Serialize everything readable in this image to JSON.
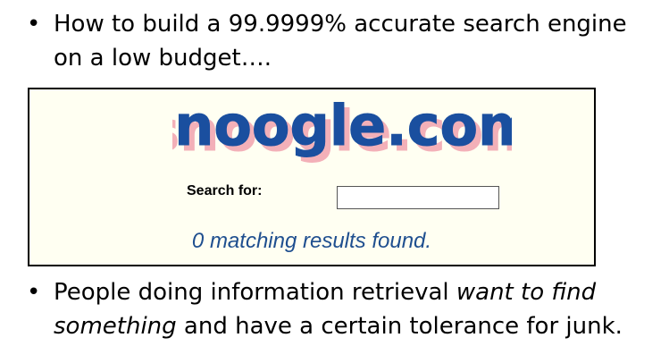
{
  "colors": {
    "logo_blue": "#1a4f9f",
    "logo_pink": "#f3b0b8",
    "results_text": "#1f4f8f",
    "frame_background": "#fffff2"
  },
  "bullets": [
    {
      "marker": "•",
      "text": "How to build a 99.9999% accurate search engine on a low budget…."
    },
    {
      "marker": "•",
      "text_pre": "People doing information retrieval ",
      "text_emphasis": "want to find something",
      "text_post": " and have a certain tolerance for junk."
    }
  ],
  "snoogle": {
    "logo_text": "snoogle.com",
    "search_label": "Search for:",
    "search_value": "",
    "results_text": "0 matching results found."
  }
}
